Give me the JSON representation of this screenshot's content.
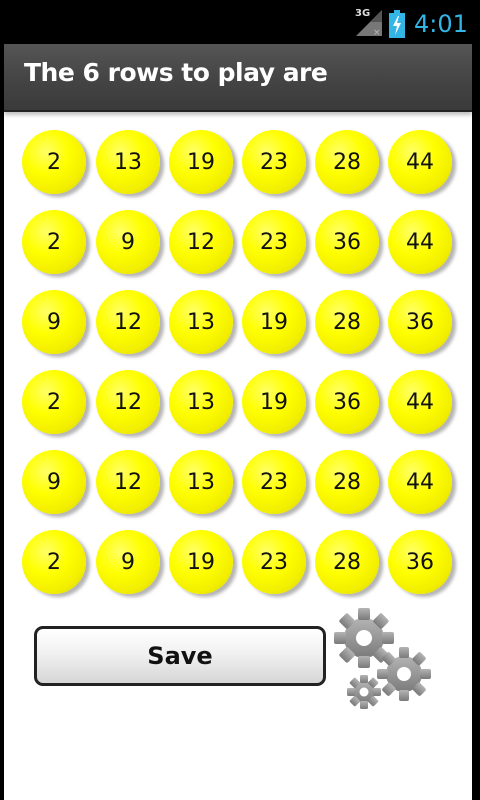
{
  "status_bar": {
    "network": "3G",
    "time": "4:01"
  },
  "header": {
    "title": "The 6 rows to play are"
  },
  "rows": [
    [
      "2",
      "13",
      "19",
      "23",
      "28",
      "44"
    ],
    [
      "2",
      "9",
      "12",
      "23",
      "36",
      "44"
    ],
    [
      "9",
      "12",
      "13",
      "19",
      "28",
      "36"
    ],
    [
      "2",
      "12",
      "13",
      "19",
      "36",
      "44"
    ],
    [
      "9",
      "12",
      "13",
      "23",
      "28",
      "44"
    ],
    [
      "2",
      "9",
      "19",
      "23",
      "28",
      "36"
    ]
  ],
  "actions": {
    "save_label": "Save"
  },
  "colors": {
    "ball": "#ffff00",
    "clock": "#33b5e5",
    "title_bar": "#444444"
  },
  "icons": {
    "settings": "gear-icon"
  }
}
